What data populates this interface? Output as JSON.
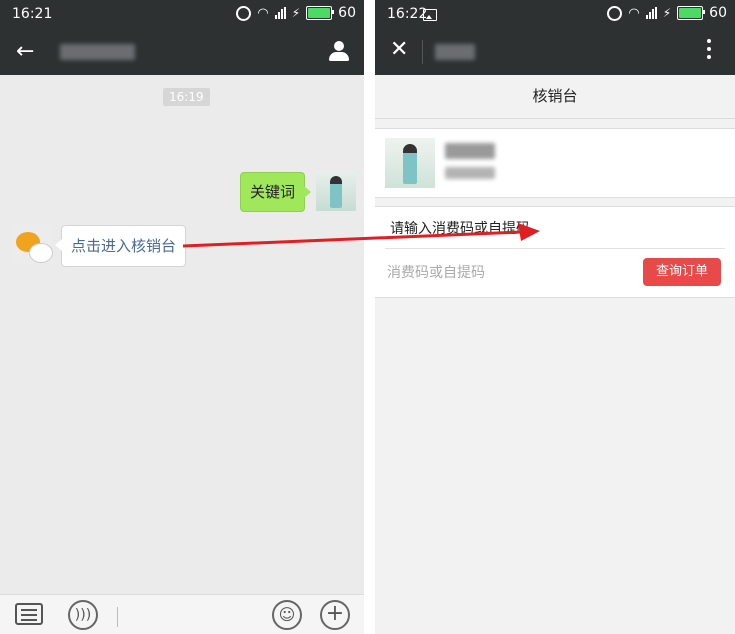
{
  "left": {
    "status": {
      "time": "16:21",
      "battery": "60"
    },
    "chat": {
      "timestamp": "16:19",
      "sent_message": "关键词",
      "received_message": "点击进入核销台"
    }
  },
  "right": {
    "status": {
      "time": "16:22",
      "battery": "60"
    },
    "header_title": "核销台",
    "form": {
      "label": "请输入消费码或自提码",
      "placeholder": "消费码或自提码",
      "button": "查询订单"
    }
  },
  "colors": {
    "appbar": "#2e3132",
    "accent": "#e84a4a",
    "bubble_green": "#a0e75a",
    "battery_green": "#4cd964"
  }
}
